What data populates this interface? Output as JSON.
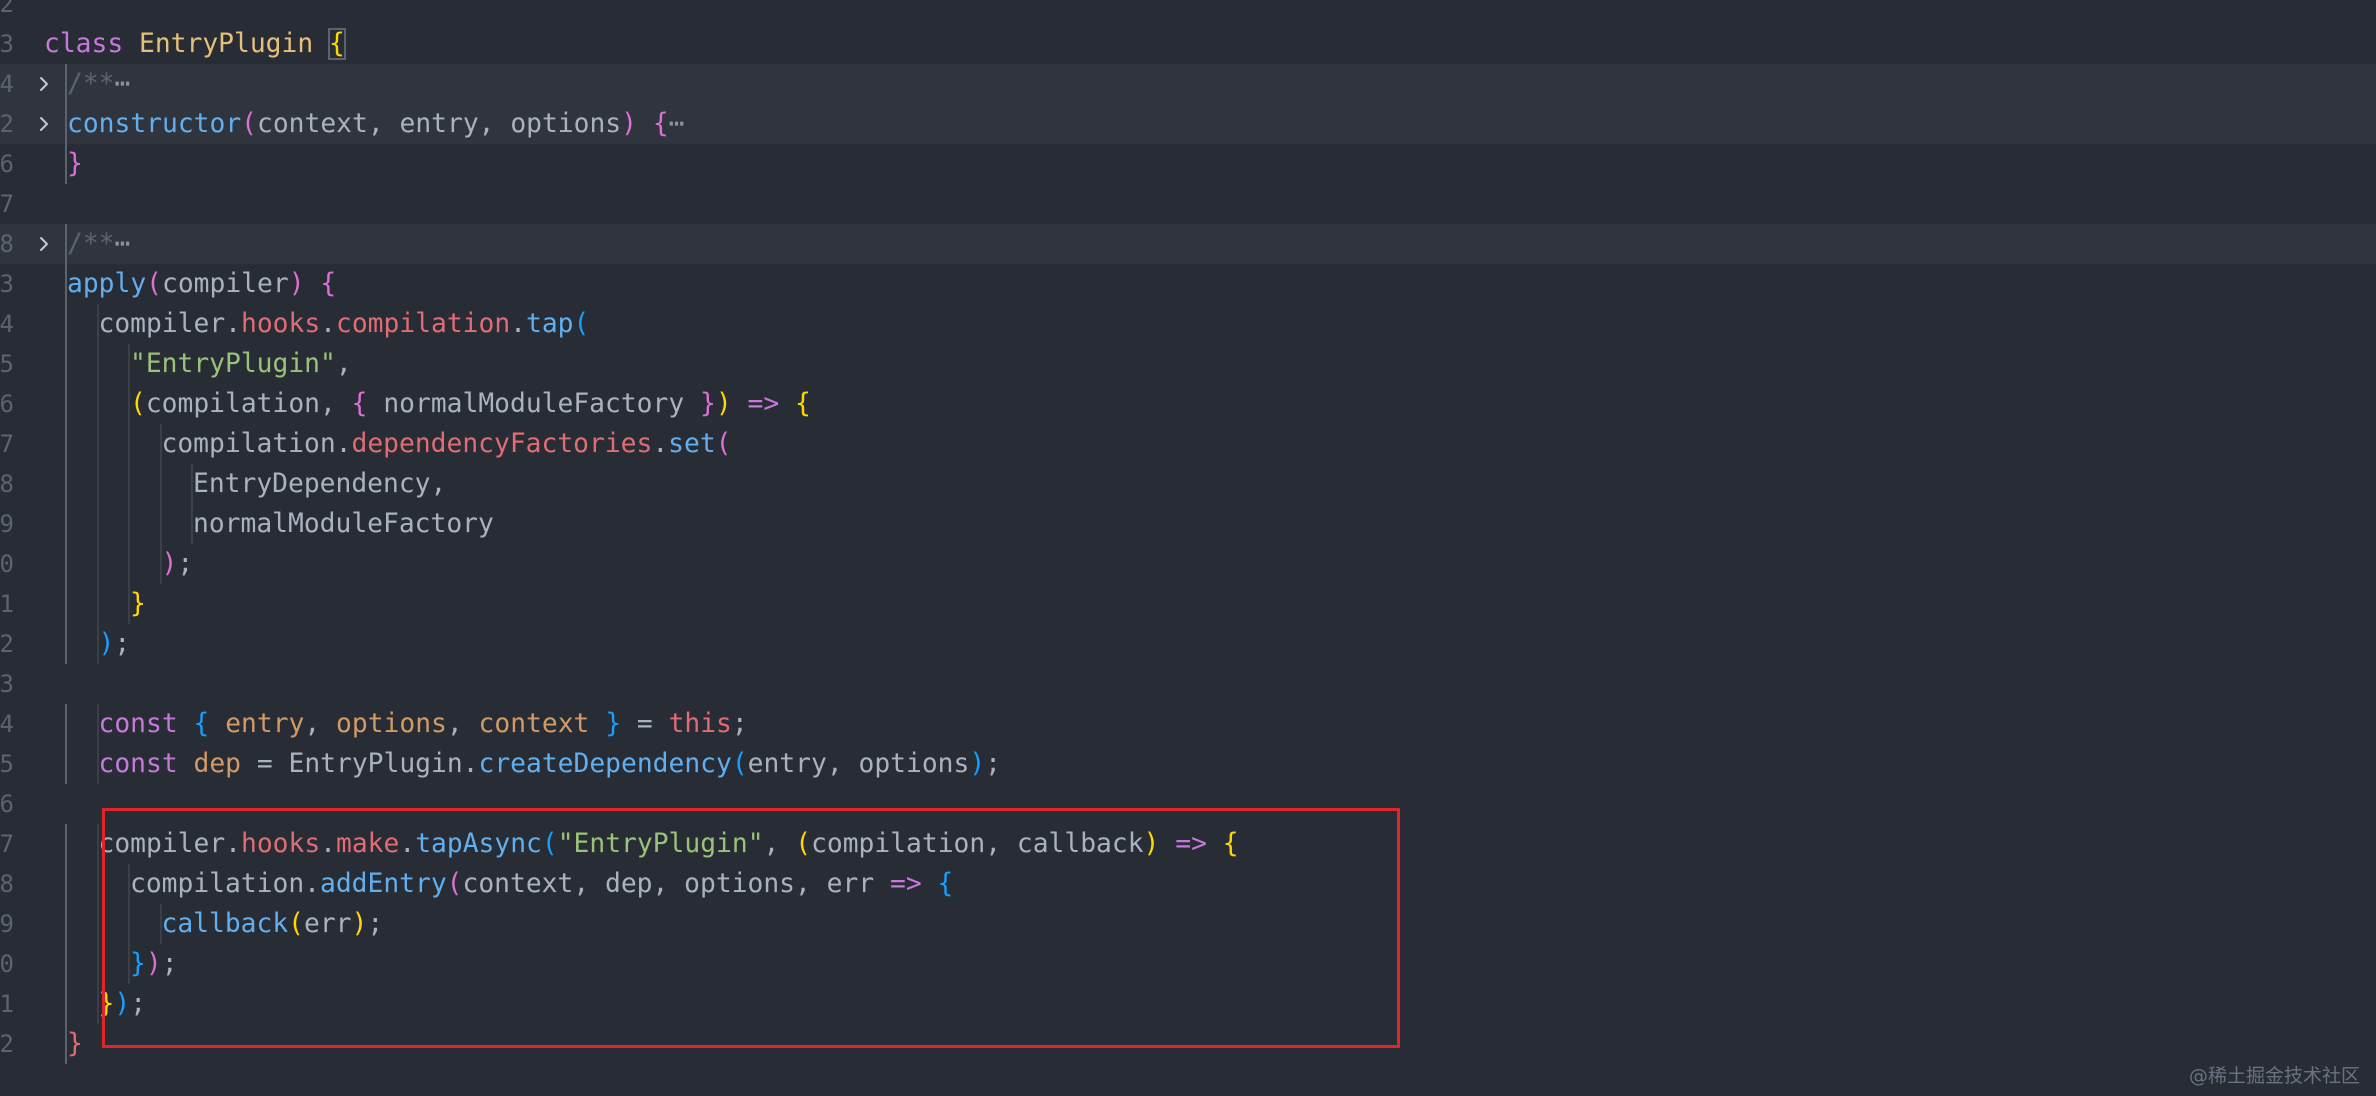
{
  "editor": {
    "lines": [
      {
        "number": "2",
        "tokens": []
      },
      {
        "number": "3",
        "indent": 0,
        "tokens": [
          {
            "t": "class",
            "c": "kw"
          },
          {
            "t": " ",
            "c": "txt"
          },
          {
            "t": "EntryPlugin",
            "c": "cls"
          },
          {
            "t": " ",
            "c": "txt"
          },
          {
            "t": "{",
            "c": "p1",
            "match": true
          }
        ]
      },
      {
        "number": "4",
        "indent": 1,
        "fold": true,
        "folded": true,
        "tokens": [
          {
            "t": "/**",
            "c": "com"
          },
          {
            "t": "⋯",
            "c": "ell"
          }
        ]
      },
      {
        "number": "2",
        "indent": 1,
        "fold": true,
        "folded": true,
        "tokens": [
          {
            "t": "constructor",
            "c": "fn"
          },
          {
            "t": "(",
            "c": "p2"
          },
          {
            "t": "context, entry, options",
            "c": "txt"
          },
          {
            "t": ")",
            "c": "p2"
          },
          {
            "t": " ",
            "c": "txt"
          },
          {
            "t": "{",
            "c": "p2"
          },
          {
            "t": "⋯",
            "c": "ell"
          }
        ]
      },
      {
        "number": "6",
        "indent": 1,
        "tokens": [
          {
            "t": "}",
            "c": "p2"
          }
        ]
      },
      {
        "number": "7",
        "tokens": []
      },
      {
        "number": "8",
        "indent": 1,
        "fold": true,
        "folded": true,
        "tokens": [
          {
            "t": "/**",
            "c": "com"
          },
          {
            "t": "⋯",
            "c": "ell"
          }
        ]
      },
      {
        "number": "3",
        "indent": 1,
        "tokens": [
          {
            "t": "apply",
            "c": "fn"
          },
          {
            "t": "(",
            "c": "p2"
          },
          {
            "t": "compiler",
            "c": "txt"
          },
          {
            "t": ")",
            "c": "p2"
          },
          {
            "t": " ",
            "c": "txt"
          },
          {
            "t": "{",
            "c": "p2"
          }
        ]
      },
      {
        "number": "4",
        "indent": 2,
        "tokens": [
          {
            "t": "compiler.",
            "c": "txt"
          },
          {
            "t": "hooks",
            "c": "prop"
          },
          {
            "t": ".",
            "c": "txt"
          },
          {
            "t": "compilation",
            "c": "prop"
          },
          {
            "t": ".",
            "c": "txt"
          },
          {
            "t": "tap",
            "c": "fn"
          },
          {
            "t": "(",
            "c": "p3"
          }
        ]
      },
      {
        "number": "5",
        "indent": 3,
        "tokens": [
          {
            "t": "\"EntryPlugin\"",
            "c": "str"
          },
          {
            "t": ",",
            "c": "txt"
          }
        ]
      },
      {
        "number": "6",
        "indent": 3,
        "tokens": [
          {
            "t": "(",
            "c": "p1"
          },
          {
            "t": "compilation, ",
            "c": "txt"
          },
          {
            "t": "{",
            "c": "p2"
          },
          {
            "t": " normalModuleFactory ",
            "c": "txt"
          },
          {
            "t": "}",
            "c": "p2"
          },
          {
            "t": ")",
            "c": "p1"
          },
          {
            "t": " ",
            "c": "txt"
          },
          {
            "t": "=>",
            "c": "kw"
          },
          {
            "t": " ",
            "c": "txt"
          },
          {
            "t": "{",
            "c": "p1"
          }
        ]
      },
      {
        "number": "7",
        "indent": 4,
        "tokens": [
          {
            "t": "compilation.",
            "c": "txt"
          },
          {
            "t": "dependencyFactories",
            "c": "prop"
          },
          {
            "t": ".",
            "c": "txt"
          },
          {
            "t": "set",
            "c": "fn"
          },
          {
            "t": "(",
            "c": "p2"
          }
        ]
      },
      {
        "number": "8",
        "indent": 5,
        "tokens": [
          {
            "t": "EntryDependency,",
            "c": "txt"
          }
        ]
      },
      {
        "number": "9",
        "indent": 5,
        "tokens": [
          {
            "t": "normalModuleFactory",
            "c": "txt"
          }
        ]
      },
      {
        "number": "0",
        "indent": 4,
        "tokens": [
          {
            "t": ")",
            "c": "p2"
          },
          {
            "t": ";",
            "c": "txt"
          }
        ]
      },
      {
        "number": "1",
        "indent": 3,
        "tokens": [
          {
            "t": "}",
            "c": "p1"
          }
        ]
      },
      {
        "number": "2",
        "indent": 2,
        "tokens": [
          {
            "t": ")",
            "c": "p3"
          },
          {
            "t": ";",
            "c": "txt"
          }
        ]
      },
      {
        "number": "3",
        "tokens": []
      },
      {
        "number": "4",
        "indent": 2,
        "tokens": [
          {
            "t": "const",
            "c": "kw"
          },
          {
            "t": " ",
            "c": "txt"
          },
          {
            "t": "{",
            "c": "p3"
          },
          {
            "t": " ",
            "c": "txt"
          },
          {
            "t": "entry",
            "c": "var"
          },
          {
            "t": ", ",
            "c": "txt"
          },
          {
            "t": "options",
            "c": "var"
          },
          {
            "t": ", ",
            "c": "txt"
          },
          {
            "t": "context",
            "c": "var"
          },
          {
            "t": " ",
            "c": "txt"
          },
          {
            "t": "}",
            "c": "p3"
          },
          {
            "t": " = ",
            "c": "txt"
          },
          {
            "t": "this",
            "c": "prop"
          },
          {
            "t": ";",
            "c": "txt"
          }
        ]
      },
      {
        "number": "5",
        "indent": 2,
        "tokens": [
          {
            "t": "const",
            "c": "kw"
          },
          {
            "t": " ",
            "c": "txt"
          },
          {
            "t": "dep",
            "c": "var"
          },
          {
            "t": " = EntryPlugin.",
            "c": "txt"
          },
          {
            "t": "createDependency",
            "c": "fn"
          },
          {
            "t": "(",
            "c": "p3"
          },
          {
            "t": "entry, options",
            "c": "txt"
          },
          {
            "t": ")",
            "c": "p3"
          },
          {
            "t": ";",
            "c": "txt"
          }
        ]
      },
      {
        "number": "6",
        "tokens": []
      },
      {
        "number": "7",
        "indent": 2,
        "tokens": [
          {
            "t": "compiler.",
            "c": "txt"
          },
          {
            "t": "hooks",
            "c": "prop"
          },
          {
            "t": ".",
            "c": "txt"
          },
          {
            "t": "make",
            "c": "prop"
          },
          {
            "t": ".",
            "c": "txt"
          },
          {
            "t": "tapAsync",
            "c": "fn"
          },
          {
            "t": "(",
            "c": "p3"
          },
          {
            "t": "\"EntryPlugin\"",
            "c": "str"
          },
          {
            "t": ", ",
            "c": "txt"
          },
          {
            "t": "(",
            "c": "p1"
          },
          {
            "t": "compilation, callback",
            "c": "txt"
          },
          {
            "t": ")",
            "c": "p1"
          },
          {
            "t": " ",
            "c": "txt"
          },
          {
            "t": "=>",
            "c": "kw"
          },
          {
            "t": " ",
            "c": "txt"
          },
          {
            "t": "{",
            "c": "p1"
          }
        ]
      },
      {
        "number": "8",
        "indent": 3,
        "tokens": [
          {
            "t": "compilation.",
            "c": "txt"
          },
          {
            "t": "addEntry",
            "c": "fn"
          },
          {
            "t": "(",
            "c": "p2"
          },
          {
            "t": "context, dep, options, err ",
            "c": "txt"
          },
          {
            "t": "=>",
            "c": "kw"
          },
          {
            "t": " ",
            "c": "txt"
          },
          {
            "t": "{",
            "c": "p3"
          }
        ]
      },
      {
        "number": "9",
        "indent": 4,
        "tokens": [
          {
            "t": "callback",
            "c": "fn"
          },
          {
            "t": "(",
            "c": "p1"
          },
          {
            "t": "err",
            "c": "txt"
          },
          {
            "t": ")",
            "c": "p1"
          },
          {
            "t": ";",
            "c": "txt"
          }
        ]
      },
      {
        "number": "0",
        "indent": 3,
        "tokens": [
          {
            "t": "}",
            "c": "p3"
          },
          {
            "t": ")",
            "c": "p2"
          },
          {
            "t": ";",
            "c": "txt"
          }
        ]
      },
      {
        "number": "1",
        "indent": 2,
        "tokens": [
          {
            "t": "}",
            "c": "p1"
          },
          {
            "t": ")",
            "c": "p3"
          },
          {
            "t": ";",
            "c": "txt"
          }
        ]
      },
      {
        "number": "2",
        "indent": 1,
        "tokens": [
          {
            "t": "}",
            "c": "prop"
          }
        ]
      }
    ]
  },
  "colors": {
    "background": "#282c34",
    "highlight_box": "#e0252b",
    "keyword": "#c678dd",
    "class_name": "#e5c07b",
    "function": "#61afef",
    "property": "#e06c75",
    "string": "#98c379",
    "variable": "#d19a66"
  },
  "icons": {
    "fold": "chevron-right-icon"
  },
  "watermark": "@稀土掘金技术社区"
}
